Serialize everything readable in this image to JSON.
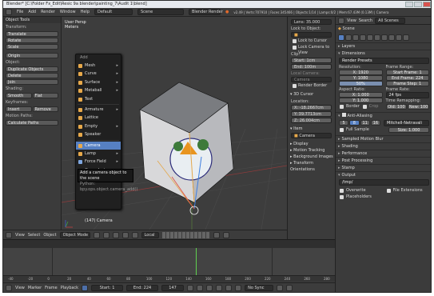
{
  "window": {
    "title": "Blender* [C:\\Folder Fx_Edit\\Resic 9a blender\\painting_7\\Audit 1\\blend]"
  },
  "menubar": {
    "items": [
      "File",
      "Add",
      "Render",
      "Window",
      "Help"
    ],
    "layout": "Default",
    "scene": "Scene",
    "engine": "Blender Render",
    "stats": "v2.49 | Verts:707910 | Faces:345466 | Objects:1/14 | Lamps:0/2 | Mem:67.43M (0.13M) | Camera"
  },
  "toolshelf": {
    "title": "Object Tools",
    "transform_label": "Transform:",
    "transform_buttons": [
      "Translate",
      "Rotate",
      "Scale"
    ],
    "origin_button": "Origin",
    "object_label": "Object:",
    "object_buttons": [
      "Duplicate Objects",
      "Delete",
      "Join"
    ],
    "shading_label": "Shading:",
    "shading_buttons": [
      "Smooth",
      "Flat"
    ],
    "keyframes_label": "Keyframes:",
    "keyframe_buttons": [
      "Insert",
      "Remove"
    ],
    "motion_label": "Motion Paths:",
    "motion_button": "Calculate Paths"
  },
  "viewport": {
    "title": "User Persp",
    "subtitle": "Meters",
    "object_label": "(147) Camera"
  },
  "add_menu": {
    "title": "Add",
    "items": [
      {
        "label": "Mesh",
        "color": "#e8a94a",
        "submenu": true
      },
      {
        "label": "Curve",
        "color": "#e8a94a",
        "submenu": true
      },
      {
        "label": "Surface",
        "color": "#e8a94a",
        "submenu": true
      },
      {
        "label": "Metaball",
        "color": "#e8a94a",
        "submenu": true
      },
      {
        "label": "Text",
        "color": "#e8a94a",
        "submenu": false
      },
      {
        "label": "Armature",
        "color": "#e8a94a",
        "submenu": true
      },
      {
        "label": "Lattice",
        "color": "#e8a94a",
        "submenu": false
      },
      {
        "label": "Empty",
        "color": "#e8a94a",
        "submenu": true
      },
      {
        "label": "Speaker",
        "color": "#e8a94a",
        "submenu": false
      },
      {
        "label": "Camera",
        "color": "#e8a94a",
        "submenu": false
      },
      {
        "label": "Lamp",
        "color": "#e8a94a",
        "submenu": true
      },
      {
        "label": "Force Field",
        "color": "#7fa7e0",
        "submenu": true
      },
      {
        "label": "Group Instance",
        "color": "#e8a94a",
        "submenu": true
      }
    ],
    "selected_index": 9
  },
  "tooltip": {
    "line1": "Add a camera object to the scene",
    "line2": "Python: bpy.ops.object.camera_add()"
  },
  "viewport_header": {
    "view": "View",
    "select": "Select",
    "object": "Object",
    "mode": "Object Mode",
    "pivot": "Local"
  },
  "npanel": {
    "lens": "Lens: 35.000",
    "lock_object_label": "Lock to Object:",
    "lock_cursor": "Lock to Cursor",
    "lock_camera": "Lock Camera to View",
    "clip_label": "Clip:",
    "clip_start": "Start: 1cm",
    "clip_end": "End: 100m",
    "local_camera_label": "Local Camera:",
    "local_camera": "Camera",
    "render_border": "Render Border",
    "cursor_header": "3D Cursor",
    "location_label": "Location:",
    "cursor_x": "X: -18.2667cm",
    "cursor_y": "Y: 39.7713cm",
    "cursor_z": "Z: 26.004cm",
    "item_header": "Item",
    "item_name": "Camera",
    "display_header": "Display",
    "motion_tracking": "Motion Tracking",
    "background_images": "Background Images",
    "transform_orientations": "Transform Orientations"
  },
  "properties": {
    "view": "View",
    "search": "Search",
    "all_scenes": "All Scenes",
    "scene": "Scene",
    "layers": "Layers",
    "dimensions": "Dimensions",
    "presets": "Render Presets",
    "resolution_label": "Resolution:",
    "res_x": "X: 1920",
    "res_y": "Y: 1080",
    "res_pct": "50%",
    "frame_range_label": "Frame Range:",
    "start_frame": "Start Frame: 1",
    "end_frame": "End Frame: 224",
    "frame_step": "Frame Step: 1",
    "aspect_label": "Aspect Ratio:",
    "aspect_x": "X: 1.000",
    "aspect_y": "Y: 1.000",
    "frame_rate_label": "Frame Rate:",
    "frame_rate": "24 fps",
    "border": "Border",
    "crop": "Crop",
    "time_remap_label": "Time Remapping:",
    "old": "Old: 100",
    "new": "New: 100",
    "anti_aliasing": "Anti-Aliasing",
    "aa_samples": [
      "5",
      "8",
      "11",
      "16"
    ],
    "aa_filter": "Mitchell-Netravali",
    "full_sample": "Full Sample",
    "aa_size": "Size: 1.000",
    "sampled_motion_blur": "Sampled Motion Blur",
    "shading": "Shading",
    "performance": "Performance",
    "post_processing": "Post Processing",
    "stamp": "Stamp",
    "output": "Output",
    "output_path": "/tmp/",
    "overwrite": "Overwrite",
    "file_extensions": "File Extensions",
    "placeholders": "Placeholders"
  },
  "timeline": {
    "ruler": [
      "-40",
      "-20",
      "0",
      "20",
      "40",
      "60",
      "80",
      "100",
      "120",
      "140",
      "160",
      "180",
      "200",
      "220",
      "240",
      "260",
      "280"
    ],
    "view": "View",
    "marker": "Marker",
    "frame": "Frame",
    "playback": "Playback",
    "start": "Start: 1",
    "end": "End: 224",
    "current": "147",
    "sync": "No Sync"
  },
  "colors": {
    "selected": "#5680c2",
    "accent_orange": "#e8a94a",
    "frame_line": "#5fd14f"
  }
}
